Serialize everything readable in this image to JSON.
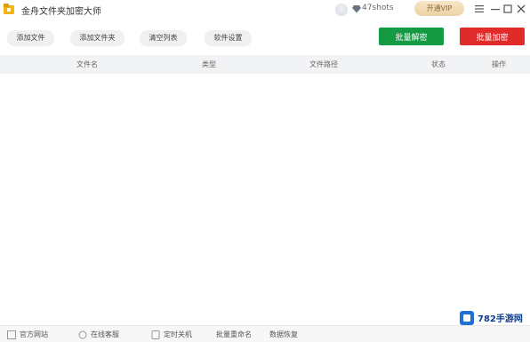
{
  "titlebar": {
    "title": "金舟文件夹加密大师",
    "shots": "47shots",
    "vip_label": "开通VIP"
  },
  "toolbar": {
    "add_file": "添加文件",
    "add_folder": "添加文件夹",
    "clear_list": "清空列表",
    "software_settings": "软件设置",
    "batch_decrypt": "批量解密",
    "batch_encrypt": "批量加密"
  },
  "table": {
    "columns": [
      "文件名",
      "类型",
      "文件路径",
      "状态",
      "操作"
    ]
  },
  "bottom": {
    "official_site": "官方网站",
    "online_support": "在线客服",
    "shutdown": "定时关机",
    "batch_rename": "批量重命名",
    "data_recovery": "数据恢复"
  },
  "watermark": {
    "text": "782手游网"
  },
  "colors": {
    "decrypt_button": "#139a43",
    "encrypt_button": "#e12a2a",
    "header_bg": "#f2f3f5"
  }
}
